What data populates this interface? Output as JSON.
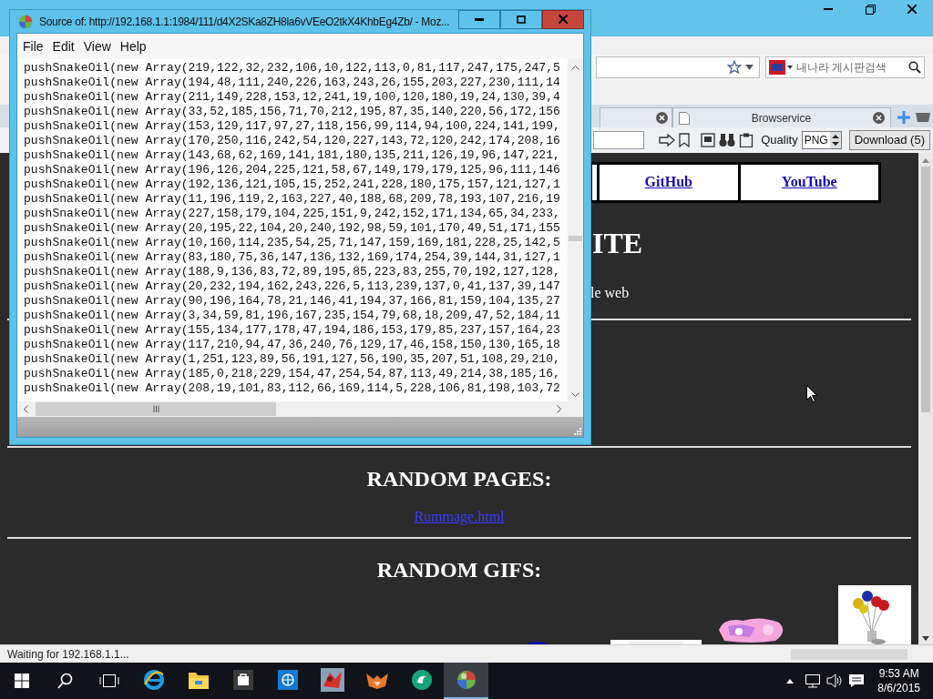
{
  "browser": {
    "tabs": [
      {
        "label": "Browservice"
      }
    ],
    "search_placeholder": "내나라 게시판검색",
    "quality_label": "Quality",
    "quality_value": "PNG",
    "download_button": "Download (5)"
  },
  "page": {
    "nav_links": [
      "GitHub",
      "YouTube"
    ],
    "heading": "ITE",
    "tagline": "le web",
    "sections": [
      {
        "title": "RANDOM PAGES:",
        "links": [
          "Rummage.html"
        ]
      },
      {
        "title": "RANDOM GIFS:"
      }
    ]
  },
  "status_bar": {
    "text": "Waiting for 192.168.1.1..."
  },
  "source_window": {
    "title": "Source of: http://192.168.1.1:1984/111/d4X2SKa8ZH8la6vVEeO2tkX4KhbEg4Zb/ - Moz...",
    "menu": [
      "File",
      "Edit",
      "View",
      "Help"
    ],
    "lines": [
      "pushSnakeOil(new Array(219,122,32,232,106,10,122,113,0,81,117,247,175,247,5",
      "pushSnakeOil(new Array(194,48,111,240,226,163,243,26,155,203,227,230,111,14",
      "pushSnakeOil(new Array(211,149,228,153,12,241,19,100,120,180,19,24,130,39,4",
      "pushSnakeOil(new Array(33,52,185,156,71,70,212,195,87,35,140,220,56,172,156",
      "pushSnakeOil(new Array(153,129,117,97,27,118,156,99,114,94,100,224,141,199,",
      "pushSnakeOil(new Array(170,250,116,242,54,120,227,143,72,120,242,174,208,16",
      "pushSnakeOil(new Array(143,68,62,169,141,181,180,135,211,126,19,96,147,221,",
      "pushSnakeOil(new Array(196,126,204,225,121,58,67,149,179,179,125,96,111,146",
      "pushSnakeOil(new Array(192,136,121,105,15,252,241,228,180,175,157,121,127,1",
      "pushSnakeOil(new Array(11,196,119,2,163,227,40,188,68,209,78,193,107,216,19",
      "pushSnakeOil(new Array(227,158,179,104,225,151,9,242,152,171,134,65,34,233,",
      "pushSnakeOil(new Array(20,195,22,104,20,240,192,98,59,101,170,49,51,171,155",
      "pushSnakeOil(new Array(10,160,114,235,54,25,71,147,159,169,181,228,25,142,5",
      "pushSnakeOil(new Array(83,180,75,36,147,136,132,169,174,254,39,144,31,127,1",
      "pushSnakeOil(new Array(188,9,136,83,72,89,195,85,223,83,255,70,192,127,128,",
      "pushSnakeOil(new Array(20,232,194,162,243,226,5,113,239,137,0,41,137,39,147",
      "pushSnakeOil(new Array(90,196,164,78,21,146,41,194,37,166,81,159,104,135,27",
      "pushSnakeOil(new Array(3,34,59,81,196,167,235,154,79,68,18,209,47,52,184,11",
      "pushSnakeOil(new Array(155,134,177,178,47,194,186,153,179,85,237,157,164,23",
      "pushSnakeOil(new Array(117,210,94,47,36,240,76,129,17,46,158,150,130,165,18",
      "pushSnakeOil(new Array(1,251,123,89,56,191,127,56,190,35,207,51,108,29,210,",
      "pushSnakeOil(new Array(185,0,218,229,154,47,254,54,87,113,49,214,38,185,16,",
      "pushSnakeOil(new Array(208,19,101,83,112,66,169,114,5,228,106,81,198,103,72"
    ]
  },
  "taskbar": {
    "apps": [
      {
        "kind": "ie",
        "selected": false
      },
      {
        "kind": "folder",
        "selected": false
      },
      {
        "kind": "store",
        "selected": false
      },
      {
        "kind": "globe",
        "selected": false
      },
      {
        "kind": "red-app",
        "selected": false
      },
      {
        "kind": "fox",
        "selected": false
      },
      {
        "kind": "green-app",
        "selected": false
      },
      {
        "kind": "sphere",
        "selected": true
      }
    ],
    "time": "9:53 AM",
    "date": "8/6/2015"
  }
}
